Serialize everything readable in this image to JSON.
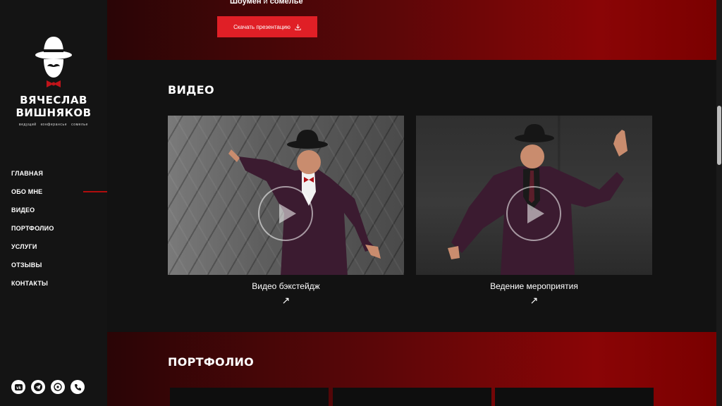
{
  "sidebar": {
    "logo": {
      "name_line1": "ВЯЧЕСЛАВ",
      "name_line2": "ВИШНЯКОВ",
      "subtitle": "ведущий конферансье сомелье"
    },
    "nav": [
      {
        "label": "ГЛАВНАЯ"
      },
      {
        "label": "ОБО МНЕ"
      },
      {
        "label": "ВИДЕО"
      },
      {
        "label": "ПОРТФОЛИО"
      },
      {
        "label": "УСЛУГИ"
      },
      {
        "label": "ОТЗЫВЫ"
      },
      {
        "label": "КОНТАКТЫ"
      }
    ],
    "active_nav": "ОБО МНЕ",
    "socials": [
      "vk-icon",
      "telegram-icon",
      "whatsapp-icon",
      "phone-icon"
    ]
  },
  "hero": {
    "tagline_bold1": "Шоумен",
    "tagline_mid": " и ",
    "tagline_bold2": "сомелье",
    "download_label": "Скачать презентацию"
  },
  "video": {
    "title": "ВИДЕО",
    "items": [
      {
        "caption": "Видео бэкстейдж",
        "arrow": "↗"
      },
      {
        "caption": "Ведение мероприятия",
        "arrow": "↗"
      }
    ]
  },
  "portfolio": {
    "title": "ПОРТФОЛИО"
  },
  "colors": {
    "accent": "#e01f26",
    "dark": "#121212",
    "band": "#7a0000"
  }
}
